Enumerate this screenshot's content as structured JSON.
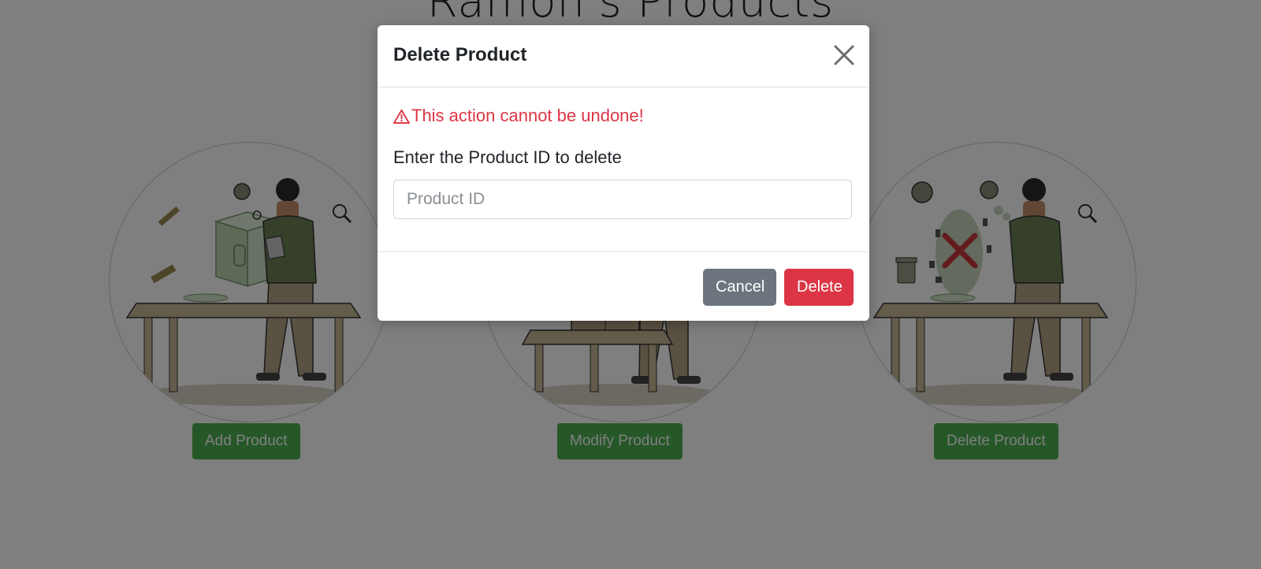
{
  "page": {
    "title": "Ramon's Products"
  },
  "cards": [
    {
      "button_label": "Add Product"
    },
    {
      "button_label": "Modify Product"
    },
    {
      "button_label": "Delete Product"
    }
  ],
  "modal": {
    "title": "Delete Product",
    "warning": "This action cannot be undone!",
    "field_label": "Enter the Product ID to delete",
    "input_placeholder": "Product ID",
    "input_value": "",
    "cancel_label": "Cancel",
    "delete_label": "Delete"
  },
  "colors": {
    "card_button": "#4caf50",
    "danger": "#dc3545",
    "secondary": "#6c757d",
    "backdrop": "rgba(0,0,0,0.5)"
  },
  "icons": [
    "close-icon",
    "warning-triangle-icon"
  ]
}
